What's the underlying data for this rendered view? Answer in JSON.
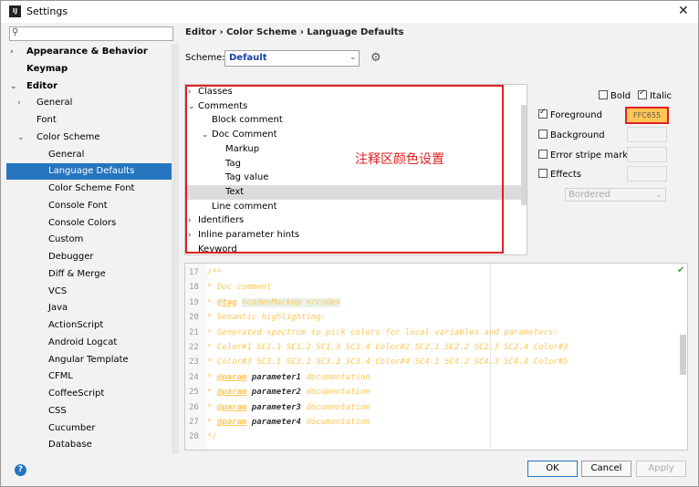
{
  "window": {
    "title": "Settings",
    "icon_text": "IJ",
    "close_glyph": "✕"
  },
  "search": {
    "placeholder": ""
  },
  "sidebar": {
    "items": [
      {
        "label": "Appearance & Behavior",
        "arrow": "›"
      },
      {
        "label": "Keymap"
      },
      {
        "label": "Editor",
        "arrow": "⌄"
      },
      {
        "label": "General",
        "arrow": "›"
      },
      {
        "label": "Font"
      },
      {
        "label": "Color Scheme",
        "arrow": "⌄"
      },
      {
        "label": "General"
      },
      {
        "label": "Language Defaults"
      },
      {
        "label": "Color Scheme Font"
      },
      {
        "label": "Console Font"
      },
      {
        "label": "Console Colors"
      },
      {
        "label": "Custom"
      },
      {
        "label": "Debugger"
      },
      {
        "label": "Diff & Merge"
      },
      {
        "label": "VCS"
      },
      {
        "label": "Java"
      },
      {
        "label": "ActionScript"
      },
      {
        "label": "Android Logcat"
      },
      {
        "label": "Angular Template"
      },
      {
        "label": "CFML"
      },
      {
        "label": "CoffeeScript"
      },
      {
        "label": "CSS"
      },
      {
        "label": "Cucumber"
      },
      {
        "label": "Database"
      }
    ]
  },
  "breadcrumb": "Editor  ›  Color Scheme  ›  Language Defaults",
  "scheme": {
    "label": "Scheme:",
    "value": "Default",
    "arrow": "⌄"
  },
  "attributes": {
    "items": [
      {
        "label": "Classes",
        "arrow": "›"
      },
      {
        "label": "Comments",
        "arrow": "⌄"
      },
      {
        "label": "Block comment"
      },
      {
        "label": "Doc Comment",
        "arrow": "⌄"
      },
      {
        "label": "Markup"
      },
      {
        "label": "Tag"
      },
      {
        "label": "Tag value"
      },
      {
        "label": "Text"
      },
      {
        "label": "Line comment"
      },
      {
        "label": "Identifiers",
        "arrow": "›"
      },
      {
        "label": "Inline parameter hints",
        "arrow": "›"
      },
      {
        "label": "Keyword"
      }
    ],
    "annotation": "注释区颜色设置"
  },
  "options": {
    "bold": {
      "label": "Bold",
      "checked": false
    },
    "italic": {
      "label": "Italic",
      "checked": true
    },
    "foreground": {
      "label": "Foreground",
      "checked": true,
      "value": "FFC655",
      "color": "#ffc655"
    },
    "background": {
      "label": "Background",
      "checked": false
    },
    "error_stripe": {
      "label": "Error stripe mark",
      "checked": false
    },
    "effects": {
      "label": "Effects",
      "checked": false
    },
    "effect_type": "Bordered"
  },
  "preview": {
    "lines": [
      {
        "n": "17",
        "text": "/**"
      },
      {
        "n": "18",
        "text": " * Doc comment"
      },
      {
        "n": "19",
        "pre": " * ",
        "tag": "@tag",
        "mid": " ",
        "code": "<code>Markup </code>",
        "post": ""
      },
      {
        "n": "20",
        "text": " * Semantic highlighting:"
      },
      {
        "n": "21",
        "text": " * Generated spectrum to pick colors for local variables and parameters:"
      },
      {
        "n": "22",
        "text": " *  Color#1 SC1.1 SC1.2 SC1.3 SC1.4 Color#2 SC2.1 SC2.2 SC2.3 SC2.4 Color#3"
      },
      {
        "n": "23",
        "text": " *  Color#3 SC3.1 SC3.2 SC3.3 SC3.4 Color#4 SC4.1 SC4.2 SC4.3 SC4.4 Color#5"
      },
      {
        "n": "24",
        "pre": " * ",
        "tag": "@param",
        "param": " parameter1",
        "post": " documentation"
      },
      {
        "n": "25",
        "pre": " * ",
        "tag": "@param",
        "param": " parameter2",
        "post": " documentation"
      },
      {
        "n": "26",
        "pre": " * ",
        "tag": "@param",
        "param": " parameter3",
        "post": " documentation"
      },
      {
        "n": "27",
        "pre": " * ",
        "tag": "@param",
        "param": " parameter4",
        "post": " documentation"
      },
      {
        "n": "28",
        "text": " */"
      }
    ]
  },
  "buttons": {
    "ok": "OK",
    "cancel": "Cancel",
    "apply": "Apply",
    "help": "?"
  },
  "colors": {
    "accent": "#2675bf",
    "highlight_red": "#e02020",
    "comment_color": "#ffc655"
  }
}
